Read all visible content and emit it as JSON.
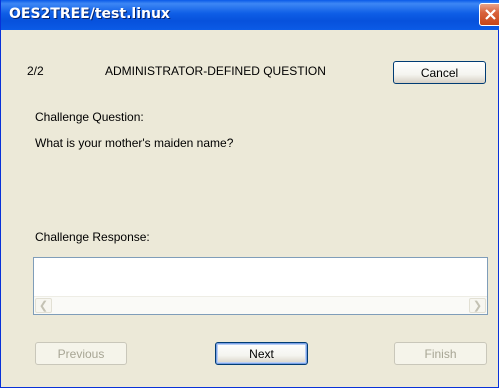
{
  "window": {
    "title": "OES2TREE/test.linux"
  },
  "progress": {
    "step": "2/2",
    "heading": "ADMINISTRATOR-DEFINED QUESTION"
  },
  "question": {
    "label": "Challenge Question:",
    "text": "What is your mother's maiden name?"
  },
  "response": {
    "label": "Challenge Response:",
    "value": ""
  },
  "buttons": {
    "cancel": "Cancel",
    "previous": "Previous",
    "next": "Next",
    "finish": "Finish"
  },
  "icons": {
    "close": "close-icon",
    "scroll_left": "scroll-left-arrow-icon",
    "scroll_right": "scroll-right-arrow-icon"
  },
  "colors": {
    "titlebar": "#0a5ae8",
    "dialog_bg": "#ece9d8",
    "close_button": "#d9633d"
  }
}
